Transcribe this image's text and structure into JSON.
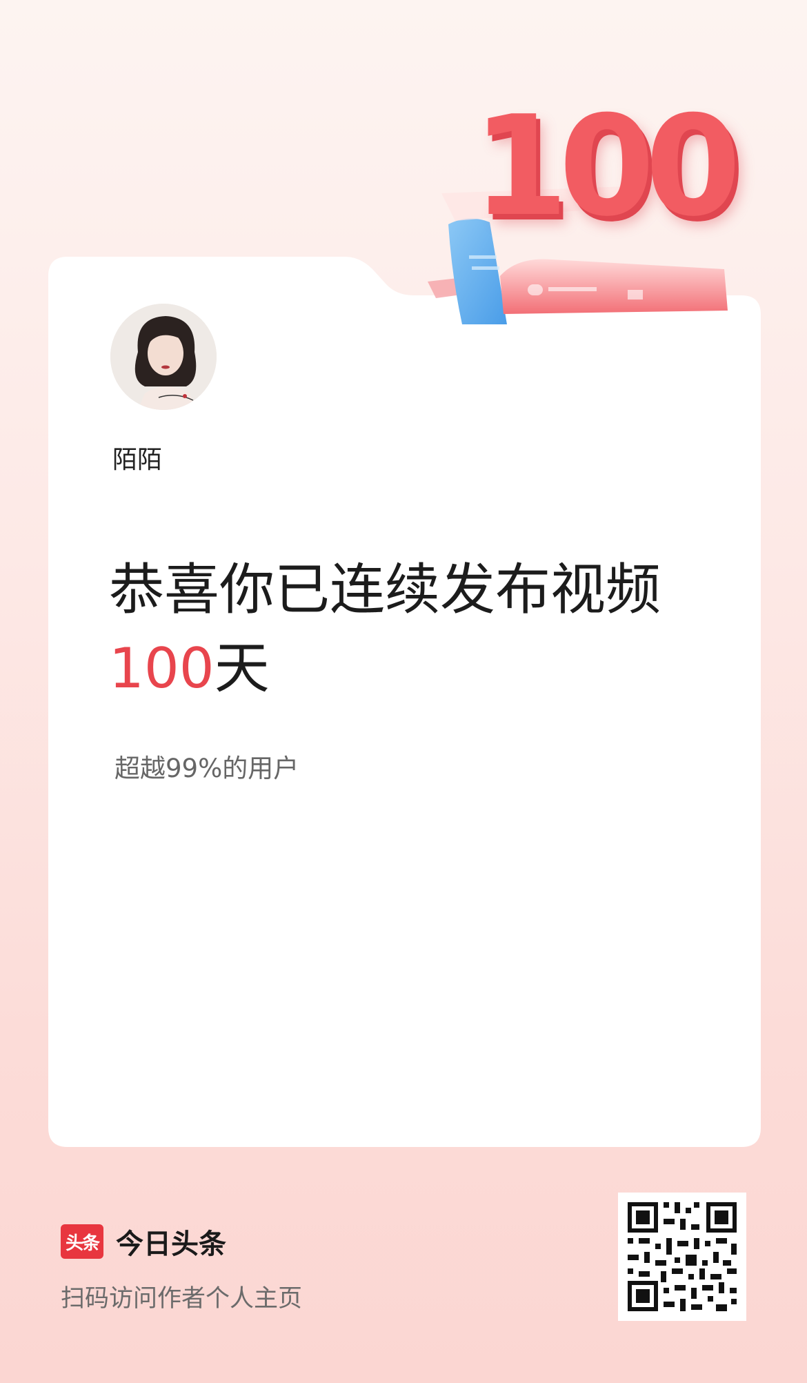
{
  "hero": {
    "number": "100"
  },
  "profile": {
    "username": "陌陌",
    "avatar_icon": "user-avatar-photo"
  },
  "achievement": {
    "headline": "恭喜你已连续发布视频",
    "days_value": "100",
    "days_unit": "天",
    "rank_text": "超越99%的用户"
  },
  "footer": {
    "brand_logo_text": "头条",
    "brand_name": "今日头条",
    "scan_text": "扫码访问作者个人主页",
    "qr_icon": "qr-code"
  },
  "colors": {
    "accent": "#e8454d",
    "brand": "#e8363f",
    "hero": "#f25c62"
  }
}
